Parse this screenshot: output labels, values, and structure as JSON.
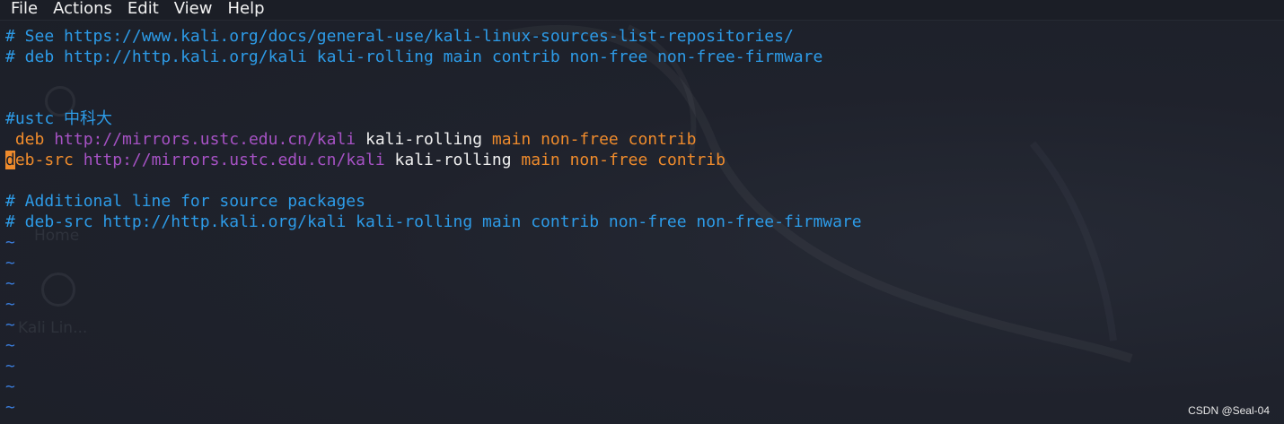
{
  "menubar": {
    "items": [
      "File",
      "Actions",
      "Edit",
      "View",
      "Help"
    ]
  },
  "desktop_ghost": {
    "home_label": "Home",
    "kali_label": "Kali Lin..."
  },
  "editor": {
    "lines": {
      "l1": "# See https://www.kali.org/docs/general-use/kali-linux-sources-list-repositories/",
      "l2": "# deb http://http.kali.org/kali kali-rolling main contrib non-free non-free-firmware",
      "l5": "#ustc 中科大",
      "l6": {
        "lead": " ",
        "type": "deb",
        "url": "http://mirrors.ustc.edu.cn/kali",
        "dist": "kali-rolling",
        "components": "main non-free contrib"
      },
      "l7": {
        "cursor_char": "d",
        "type_rest": "eb-src",
        "url": "http://mirrors.ustc.edu.cn/kali",
        "dist": "kali-rolling",
        "components": "main non-free contrib"
      },
      "l9": "# Additional line for source packages",
      "l10": "# deb-src http://http.kali.org/kali kali-rolling main contrib non-free non-free-firmware"
    },
    "tilde": "~"
  },
  "watermark": "CSDN @Seal-04",
  "colors": {
    "background": "#1e212b",
    "comment": "#2d9be7",
    "keyword": "#ef8b2c",
    "url": "#a652c4",
    "distribution": "#f0f0f0",
    "tilde": "#3a7bd8",
    "cursor": "#ef8b2c"
  }
}
